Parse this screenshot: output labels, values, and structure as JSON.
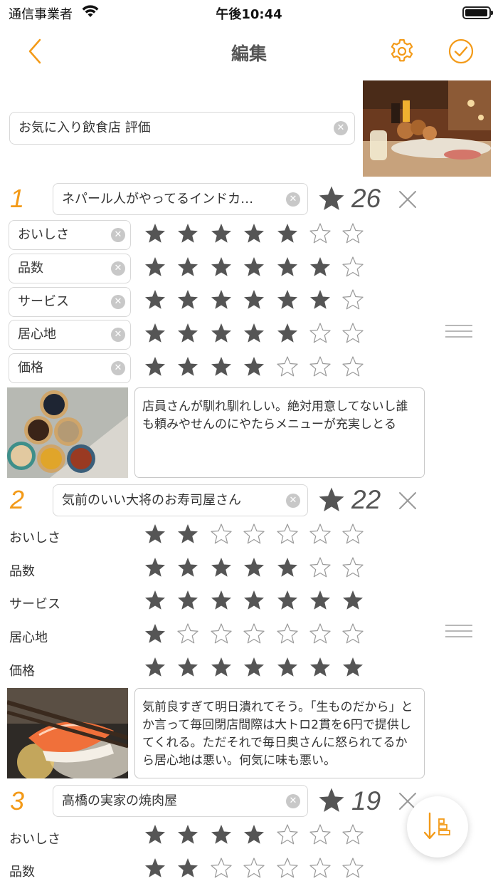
{
  "status_bar": {
    "carrier": "通信事業者",
    "time": "午後10:44"
  },
  "nav": {
    "title": "編集",
    "back_icon": "chevron-left-icon",
    "settings_icon": "gear-icon",
    "done_icon": "check-circle-icon"
  },
  "colors": {
    "accent": "#f39a18",
    "star": "#555555"
  },
  "list_title": "お気に入り飲食店 評価",
  "entries": [
    {
      "rank": "1",
      "name": "ネパール人がやってるインドカ…",
      "score": "26",
      "categories": [
        {
          "label": "おいしさ",
          "stars": 5
        },
        {
          "label": "品数",
          "stars": 6
        },
        {
          "label": "サービス",
          "stars": 6
        },
        {
          "label": "居心地",
          "stars": 5
        },
        {
          "label": "価格",
          "stars": 4
        }
      ],
      "comment": "店員さんが馴れ馴れしい。絶対用意してないし誰も頼みやせんのにやたらメニューが充実しとる"
    },
    {
      "rank": "2",
      "name": "気前のいい大将のお寿司屋さん",
      "score": "22",
      "categories": [
        {
          "label": "おいしさ",
          "stars": 2
        },
        {
          "label": "品数",
          "stars": 5
        },
        {
          "label": "サービス",
          "stars": 7
        },
        {
          "label": "居心地",
          "stars": 1
        },
        {
          "label": "価格",
          "stars": 7
        }
      ],
      "comment": "気前良すぎて明日潰れてそう。「生ものだから」とか言って毎回閉店間際は大トロ2貫を6円で提供してくれる。ただそれで毎日奥さんに怒られてるから居心地は悪い。何気に味も悪い。"
    },
    {
      "rank": "3",
      "name": "高橋の実家の焼肉屋",
      "score": "19",
      "categories": [
        {
          "label": "おいしさ",
          "stars": 4
        },
        {
          "label": "品数",
          "stars": 2
        }
      ]
    }
  ],
  "max_stars": 7
}
